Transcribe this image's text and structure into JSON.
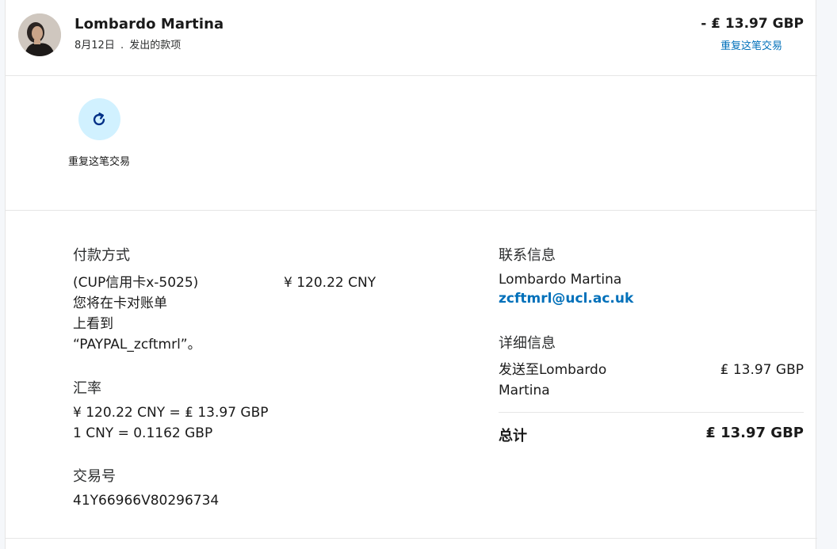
{
  "header": {
    "name": "Lombardo Martina",
    "date": "8月12日",
    "separator": ".",
    "type": "发出的款项",
    "amount": "- ₤ 13.97 GBP",
    "repeat_link": "重复这笔交易"
  },
  "actions": {
    "repeat_label": "重复这笔交易"
  },
  "payment": {
    "label": "付款方式",
    "line1": "(CUP信用卡x-5025)",
    "line2": "您将在卡对账单",
    "line3": "上看到",
    "line4": "“PAYPAL_zcftmrl”。",
    "amount": "¥ 120.22 CNY"
  },
  "exchange": {
    "label": "汇率",
    "line1": "¥ 120.22 CNY = ₤ 13.97 GBP",
    "line2": "1 CNY = 0.1162 GBP"
  },
  "transaction": {
    "label": "交易号",
    "id": "41Y66966V80296734"
  },
  "contact": {
    "label": "联系信息",
    "name": "Lombardo Martina",
    "email": "zcftmrl@ucl.ac.uk"
  },
  "details": {
    "label": "详细信息",
    "sent_to_line1": "发送至Lombardo",
    "sent_to_line2": "Martina",
    "amount": "₤ 13.97 GBP"
  },
  "total": {
    "label": "总计",
    "amount": "₤ 13.97 GBP"
  },
  "colors": {
    "link": "#0070ba",
    "action_bg": "#d1f1ff",
    "icon": "#003087"
  },
  "icons": {
    "avatar": "avatar-photo",
    "repeat": "refresh-icon"
  }
}
